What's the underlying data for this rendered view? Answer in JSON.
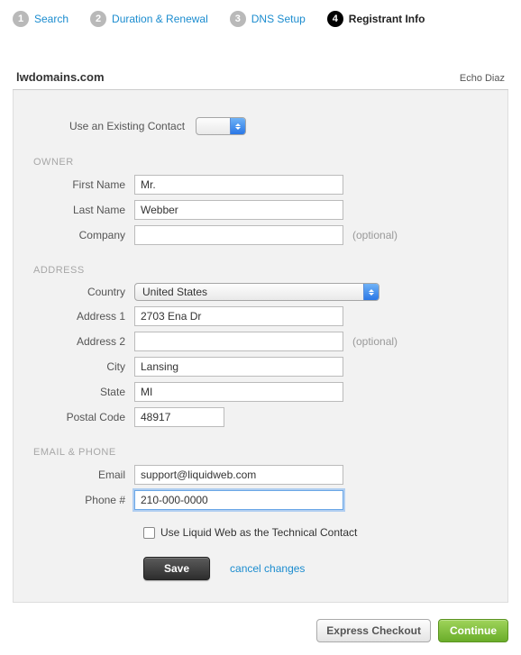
{
  "steps": [
    {
      "num": "1",
      "label": "Search"
    },
    {
      "num": "2",
      "label": "Duration & Renewal"
    },
    {
      "num": "3",
      "label": "DNS Setup"
    },
    {
      "num": "4",
      "label": "Registrant Info"
    }
  ],
  "domain": "lwdomains.com",
  "user": "Echo Diaz",
  "existing_contact": {
    "label": "Use an Existing Contact",
    "value": ""
  },
  "sections": {
    "owner_head": "OWNER",
    "address_head": "ADDRESS",
    "email_head": "EMAIL & PHONE"
  },
  "labels": {
    "first_name": "First Name",
    "last_name": "Last Name",
    "company": "Company",
    "country": "Country",
    "address1": "Address 1",
    "address2": "Address 2",
    "city": "City",
    "state": "State",
    "postal": "Postal Code",
    "email": "Email",
    "phone": "Phone #",
    "optional": "(optional)"
  },
  "values": {
    "first_name": "Mr.",
    "last_name": "Webber",
    "company": "",
    "country": "United States",
    "address1": "2703 Ena Dr",
    "address2": "",
    "city": "Lansing",
    "state": "MI",
    "postal": "48917",
    "email": "support@liquidweb.com",
    "phone": "210-000-0000"
  },
  "tech_contact_label": "Use Liquid Web as the Technical Contact",
  "buttons": {
    "save": "Save",
    "cancel": "cancel changes",
    "express": "Express Checkout",
    "continue": "Continue"
  }
}
